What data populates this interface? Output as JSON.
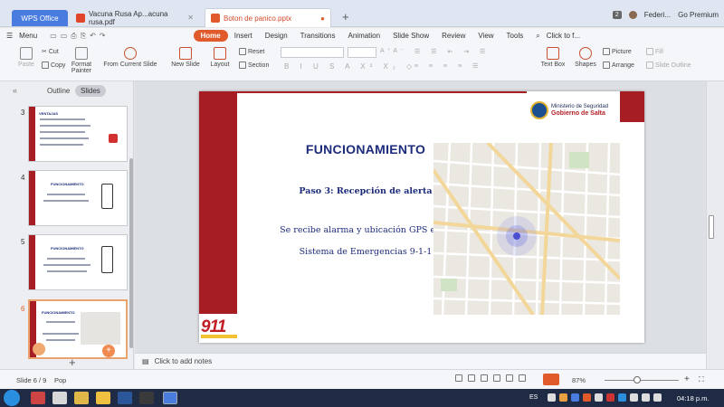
{
  "tabs": [
    {
      "label": "WPS Office"
    },
    {
      "label": "Vacuna Rusa Ap...acuna rusa.pdf"
    },
    {
      "label": "Boton de panico.pptx"
    }
  ],
  "titlebar": {
    "badge": "2",
    "user": "Federi...",
    "premium": "Go Premium"
  },
  "menu": {
    "menu_label": "Menu",
    "items": [
      "Home",
      "Insert",
      "Design",
      "Transitions",
      "Animation",
      "Slide Show",
      "Review",
      "View",
      "Tools"
    ],
    "search": "Click to f..."
  },
  "ribbon": {
    "paste": "Paste",
    "cut": "Cut",
    "copy": "Copy",
    "format_painter": "Format Painter",
    "from_current": "From Current Slide",
    "new_slide": "New Slide",
    "layout": "Layout",
    "reset": "Reset",
    "section": "Section",
    "text_box": "Text Box",
    "shapes": "Shapes",
    "picture": "Picture",
    "arrange": "Arrange",
    "fill": "Fill",
    "slide_outline": "Slide Outline"
  },
  "left_panel": {
    "outline": "Outline",
    "slides": "Slides",
    "thumb_numbers": [
      "3",
      "4",
      "5",
      "6"
    ],
    "thumb_titles": [
      "VENTAJAS",
      "FUNCIONAMIENTO",
      "FUNCIONAMIENTO",
      "FUNCIONAMIENTO"
    ]
  },
  "slide": {
    "logo_line1": "Ministerio de Seguridad",
    "logo_line2": "Gobierno de Salta",
    "title": "FUNCIONAMIENTO",
    "step": "Paso 3: Recepción de alerta",
    "body_line1": "Se recibe alarma y ubicación GPS en el",
    "body_line2": "Sistema de Emergencias 9-1-1",
    "logo_911": "911"
  },
  "notes": {
    "placeholder": "Click to add notes"
  },
  "status": {
    "slide_counter": "Slide 6 / 9",
    "language": "Pop",
    "zoom": "87%"
  },
  "taskbar": {
    "lang": "ES",
    "time": "04:18 p.m."
  },
  "colors": {
    "accent": "#e05a2b",
    "slide_red": "#a61d24",
    "title_blue": "#1c2b7a",
    "wps_blue": "#4a7ce0"
  }
}
